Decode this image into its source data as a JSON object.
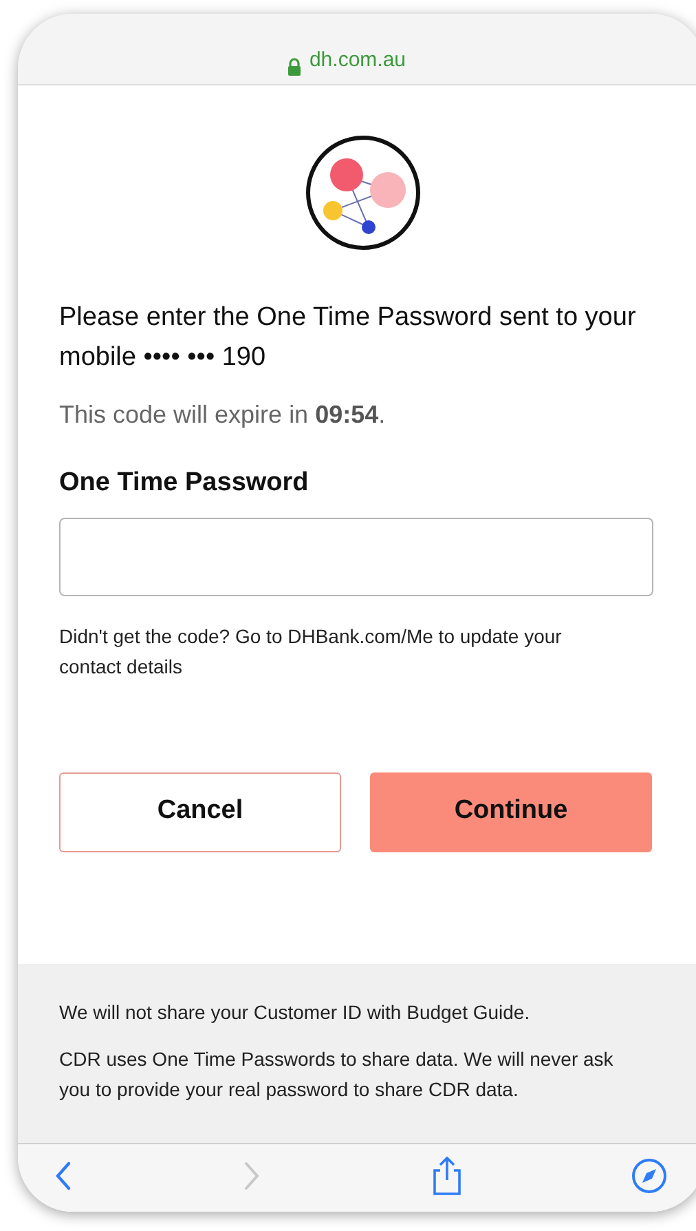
{
  "address_bar": {
    "domain": "dh.com.au",
    "secure": true
  },
  "prompt": "Please enter the One Time Password sent to your mobile •••• ••• 190",
  "expiry": "This code will expire in **09:54**.",
  "otp_field": {
    "label": "One Time Password"
  },
  "help_text": "Didn't get the code? Go to DHBank.com/Me to update your contact details",
  "buttons": [
    {
      "label": "Cancel",
      "kind": "secondary"
    },
    {
      "label": "Continue",
      "kind": "primary"
    }
  ],
  "footer_notes": [
    "We will not share your Customer ID with Budget Guide.",
    "CDR uses One Time Passwords to share data. We will never ask you to provide your real password to share CDR data."
  ],
  "toolbar": [
    {
      "kind": "back",
      "disabled": false
    },
    {
      "kind": "forward",
      "disabled": true
    },
    {
      "kind": "share",
      "disabled": false
    },
    {
      "kind": "compass",
      "disabled": false
    }
  ]
}
